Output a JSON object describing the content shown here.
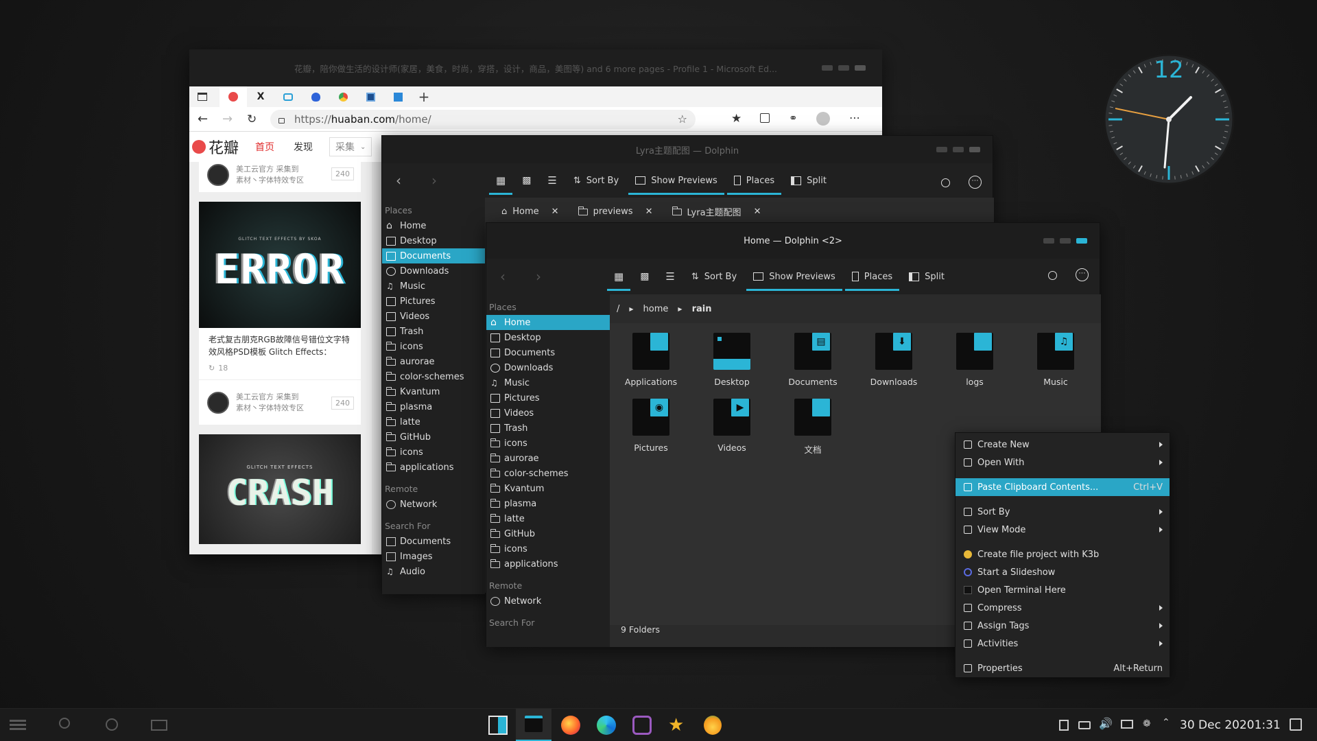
{
  "edge": {
    "title": "花瓣，陪你做生活的设计师(家居，美食，时尚，穿搭，设计，商品，美图等) and 6 more pages - Profile 1 - Microsoft Ed...",
    "url_prefix": "https://",
    "url_host": "huaban.com",
    "url_path": "/home/",
    "logo_text": "花瓣",
    "nav": [
      "首页",
      "发现",
      "采集"
    ],
    "cards": [
      {
        "user": "美工云官方 采集到",
        "board": "素材丶字体特效专区",
        "count": "240"
      },
      {
        "image_text": "ERROR",
        "image_sub": "GLITCH TEXT EFFECTS BY SKOA",
        "desc": "老式复古朋克RGB故障信号错位文字特效风格PSD模板 Glitch Effects：",
        "repins": "18"
      },
      {
        "user": "美工云官方 采集到",
        "board": "素材丶字体特效专区",
        "count": "240"
      },
      {
        "image_text": "CRASH",
        "image_sub": "GLITCH TEXT EFFECTS"
      }
    ]
  },
  "dolphin1": {
    "title": "Lyra主题配图 — Dolphin",
    "toolbar": [
      "Sort By",
      "Show Previews",
      "Places",
      "Split"
    ],
    "tabs": [
      "Home",
      "previews",
      "Lyra主题配图"
    ],
    "places_header": "Places",
    "places": [
      "Home",
      "Desktop",
      "Documents",
      "Downloads",
      "Music",
      "Pictures",
      "Videos",
      "Trash",
      "icons",
      "aurorae",
      "color-schemes",
      "Kvantum",
      "plasma",
      "latte",
      "GitHub",
      "icons",
      "applications"
    ],
    "remote_header": "Remote",
    "remote": [
      "Network"
    ],
    "search_header": "Search For",
    "search": [
      "Documents",
      "Images",
      "Audio"
    ]
  },
  "dolphin2": {
    "title": "Home — Dolphin <2>",
    "toolbar": [
      "Sort By",
      "Show Previews",
      "Places",
      "Split"
    ],
    "places_header": "Places",
    "places": [
      "Home",
      "Desktop",
      "Documents",
      "Downloads",
      "Music",
      "Pictures",
      "Videos",
      "Trash",
      "icons",
      "aurorae",
      "color-schemes",
      "Kvantum",
      "plasma",
      "latte",
      "GitHub",
      "icons",
      "applications"
    ],
    "remote_header": "Remote",
    "remote": [
      "Network"
    ],
    "search_header": "Search For",
    "breadcrumb": [
      "/",
      "home",
      "rain"
    ],
    "files": [
      "Applications",
      "Desktop",
      "Documents",
      "Downloads",
      "logs",
      "Music",
      "Pictures",
      "Videos",
      "文档"
    ],
    "status": "9 Folders"
  },
  "context_menu": {
    "items": [
      {
        "label": "Create New",
        "sub": true
      },
      {
        "label": "Open With",
        "sub": true
      },
      {
        "label": "Paste Clipboard Contents...",
        "shortcut": "Ctrl+V",
        "highlight": true
      },
      {
        "label": "Sort By",
        "sub": true
      },
      {
        "label": "View Mode",
        "sub": true
      },
      {
        "label": "Create file project with K3b"
      },
      {
        "label": "Start a Slideshow"
      },
      {
        "label": "Open Terminal Here"
      },
      {
        "label": "Compress",
        "sub": true
      },
      {
        "label": "Assign Tags",
        "sub": true
      },
      {
        "label": "Activities",
        "sub": true
      },
      {
        "label": "Properties",
        "shortcut": "Alt+Return"
      }
    ]
  },
  "clock": {
    "twelve": "12",
    "accent": "#2bb5d6",
    "second_hand": "#e8a040"
  },
  "taskbar": {
    "date": "30 Dec 2020",
    "time": "1:31"
  },
  "colors": {
    "accent": "#2aa6c6",
    "folder_dark": "#0d0d0d"
  }
}
